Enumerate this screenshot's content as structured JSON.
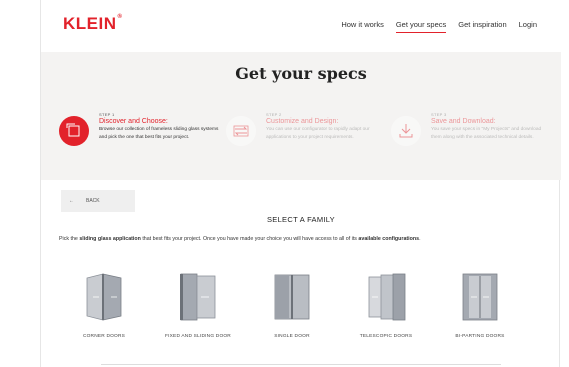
{
  "header": {
    "logo": "KLEIN",
    "logo_mark": "®",
    "nav": [
      "How it works",
      "Get your specs",
      "Get inspiration",
      "Login"
    ]
  },
  "hero": {
    "title": "Get your specs",
    "steps": [
      {
        "num": "STEP 1",
        "title": "Discover and Choose:",
        "desc": "Browse our collection of frameless sliding glass systems and pick the one that best fits your project.",
        "icon": "square-stack-icon"
      },
      {
        "num": "STEP 2",
        "title": "Customize and Design:",
        "desc": "You can use our configurator to rapidly adapt our applications to your project requirements.",
        "icon": "arrows-cycle-icon"
      },
      {
        "num": "STEP 3",
        "title": "Save and Download:",
        "desc": "You save your specs in \"My Projects\" and download them along with the associated technical details.",
        "icon": "download-tray-icon"
      }
    ]
  },
  "back": {
    "arrow": "←",
    "label": "BACK"
  },
  "section": {
    "title": "SELECT A FAMILY",
    "instr_a": "Pick the ",
    "instr_b": "sliding glass application",
    "instr_c": " that best fits your project. Once you have made your choice you will have access to all of its ",
    "instr_d": "available configurations",
    "instr_e": "."
  },
  "families": [
    {
      "label": "CORNER DOORS"
    },
    {
      "label": "FIXED AND SLIDING DOOR"
    },
    {
      "label": "SINGLE DOOR"
    },
    {
      "label": "TELESCOPIC DOORS"
    },
    {
      "label": "BI-PARTING DOORS"
    }
  ],
  "colors": {
    "accent": "#e2222b",
    "hero_bg": "#f4f3f2"
  }
}
